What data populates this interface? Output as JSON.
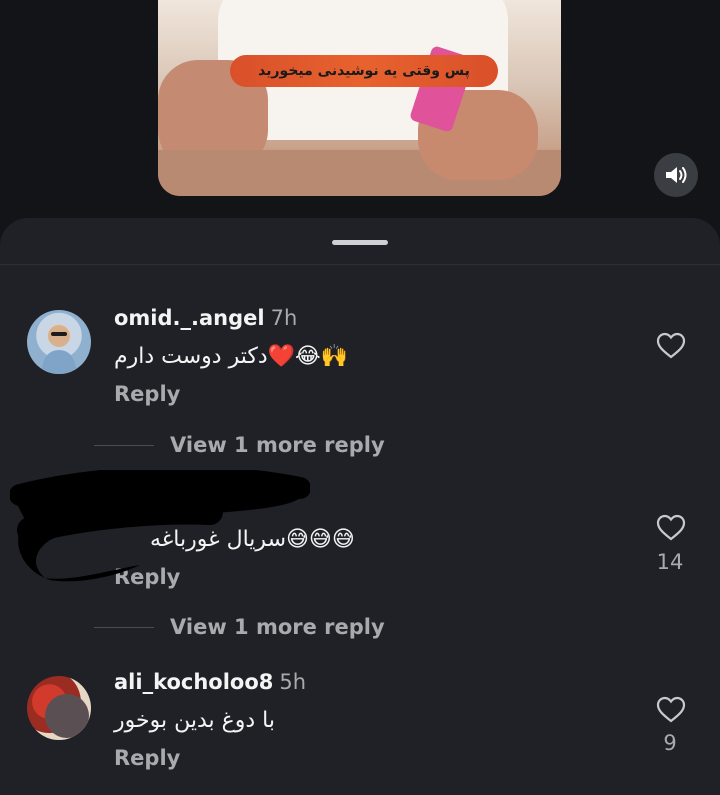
{
  "video": {
    "subtitle": "پس وقتی یه نوشیدنی میخورید",
    "sound_icon": "speaker-icon"
  },
  "comments": [
    {
      "username": "omid._.angel",
      "time": "7h",
      "text": "دکتر دوست دارم❤️😂🙌",
      "reply": "Reply",
      "likes": "",
      "view_more": "View 1 more reply"
    },
    {
      "username": "",
      "time": "",
      "text": "سریال غورباغه😅😅😅",
      "reply": "Reply",
      "likes": "14",
      "view_more": "View 1 more reply"
    },
    {
      "username": "ali_kocholoo8",
      "time": "5h",
      "text": "با دوغ بدین بوخور",
      "reply": "Reply",
      "likes": "9",
      "view_more": ""
    }
  ],
  "colors": {
    "background": "#121417",
    "sheet": "#1f2126",
    "secondary_text": "#a8aaae",
    "subtitle_bg": "#e8622e"
  }
}
